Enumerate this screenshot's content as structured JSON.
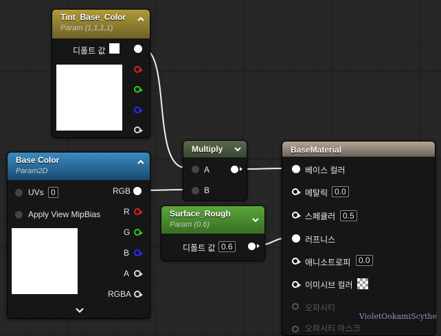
{
  "nodes": {
    "tint": {
      "title": "Tint_Base_Color",
      "subtitle": "Param (1,1,1,1)",
      "default_label": "디폴트 값"
    },
    "base_color": {
      "title": "Base Color",
      "subtitle": "Param2D",
      "uvs_label": "UVs",
      "uvs_value": "0",
      "mipbias_label": "Apply View MipBias",
      "outputs": [
        "RGB",
        "R",
        "G",
        "B",
        "A",
        "RGBA"
      ]
    },
    "multiply": {
      "title": "Multiply",
      "input_a": "A",
      "input_b": "B"
    },
    "surface_rough": {
      "title": "Surface_Rough",
      "subtitle": "Param (0.6)",
      "default_label": "디폴트 값",
      "default_value": "0.6"
    },
    "base_material": {
      "title": "BaseMaterial",
      "pins": [
        {
          "label": "베이스 컬러",
          "value": ""
        },
        {
          "label": "메탈릭",
          "value": "0.0"
        },
        {
          "label": "스페큘러",
          "value": "0.5"
        },
        {
          "label": "러프니스",
          "value": ""
        },
        {
          "label": "애니소트로피",
          "value": "0.0"
        },
        {
          "label": "이미시브 컬러",
          "value": ""
        },
        {
          "label": "오파시티",
          "value": ""
        },
        {
          "label": "오파시티 마스크",
          "value": ""
        }
      ]
    }
  },
  "colors": {
    "param_header": "#8a7a2e",
    "texture_header": "#2a6a9a",
    "math_header": "#4a5a3e",
    "scalar_header": "#4e8a30",
    "material_header": "#9a8a7c",
    "pin_red": "#e02020",
    "pin_green": "#20d020",
    "pin_blue": "#2030ff"
  },
  "watermark": "VioletOokamiScythe"
}
